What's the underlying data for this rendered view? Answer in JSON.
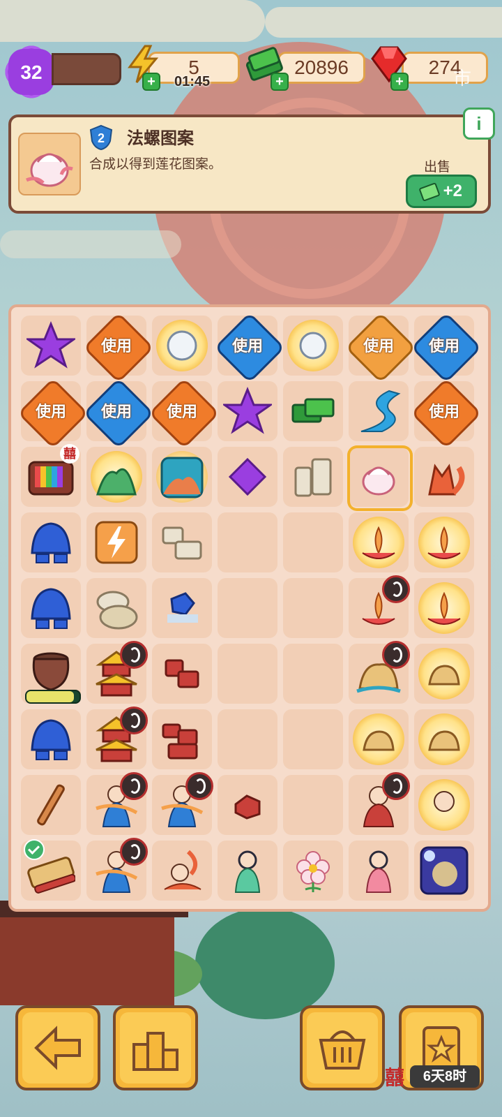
{
  "topbar": {
    "level": "32",
    "energy": "5",
    "energy_timer": "01:45",
    "cash": "20896",
    "gems": "274",
    "overlay_text": "市"
  },
  "info": {
    "level": "2",
    "title": "法螺图案",
    "description": "合成以得到莲花图案。",
    "sell_label": "出售",
    "sell_reward": "+2",
    "info_icon": "i"
  },
  "board": {
    "use_label": "使用",
    "progress_fraction": 0.9,
    "tv_badge": "囍"
  },
  "bottom": {
    "event_icon": "囍",
    "event_timer": "6天8时"
  },
  "colors": {
    "accent_orange": "#f6b73a",
    "panel_bg": "#f7e7c5",
    "board_bg": "#f6dccb",
    "green": "#3fb26a"
  },
  "icons": [
    "level-star-icon",
    "energy-bolt-icon",
    "cash-icon",
    "gem-icon",
    "info-icon",
    "back-arrow-icon",
    "podium-icon",
    "basket-icon",
    "task-board-icon"
  ]
}
